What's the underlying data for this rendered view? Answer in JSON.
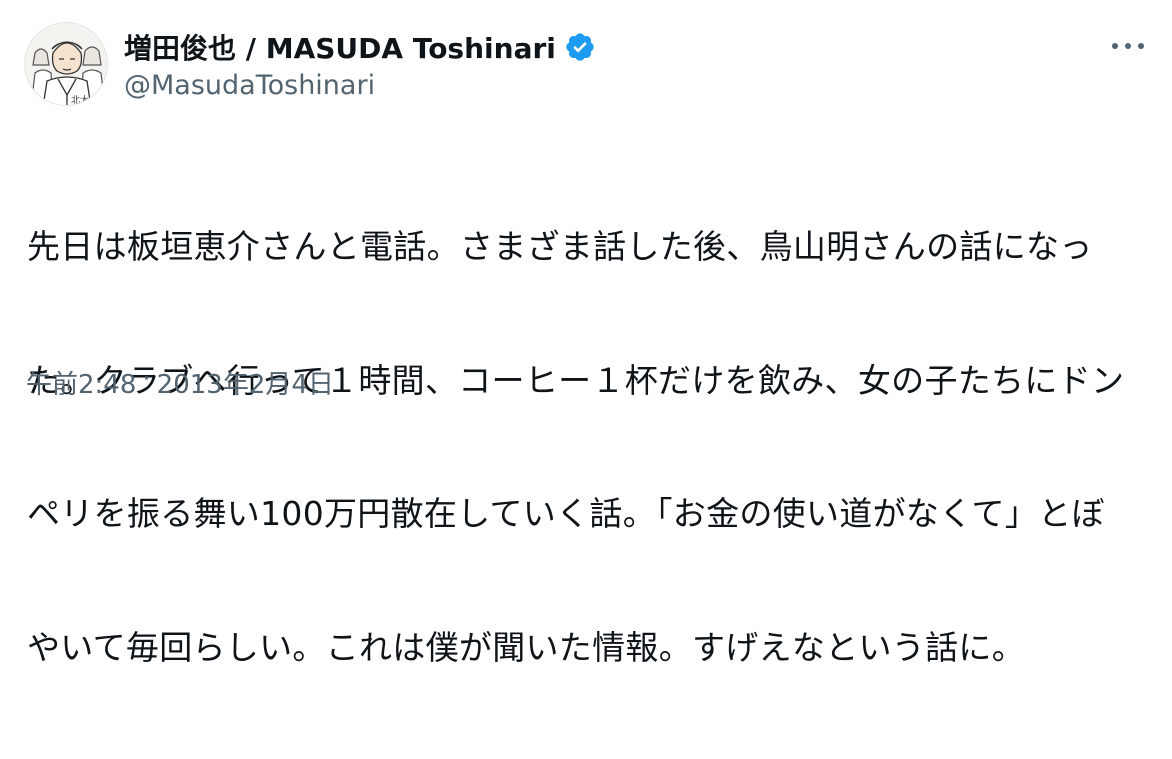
{
  "author": {
    "display_name": "増田俊也 / MASUDA Toshinari",
    "handle": "@MasudaToshinari",
    "verified": true,
    "avatar_text": "北大"
  },
  "tweet": {
    "lines": [
      "先日は板垣恵介さんと電話。さまざま話した後、鳥山明さんの話になっ",
      "た。クラブへ行って１時間、コーヒー１杯だけを飲み、女の子たちにドン",
      "ペリを振る舞い100万円散在していく話。「お金の使い道がなくて」とぼ",
      "やいて毎回らしい。これは僕が聞いた情報。すげえなという話に。"
    ]
  },
  "meta": {
    "time": "午前2:48",
    "separator": "·",
    "date": "2013年2月4日"
  },
  "icons": {
    "more": "more-horizontal-icon",
    "verified": "verified-badge-icon"
  },
  "colors": {
    "verified_blue": "#1d9bf0",
    "secondary_text": "#536471",
    "primary_text": "#0f1419"
  }
}
